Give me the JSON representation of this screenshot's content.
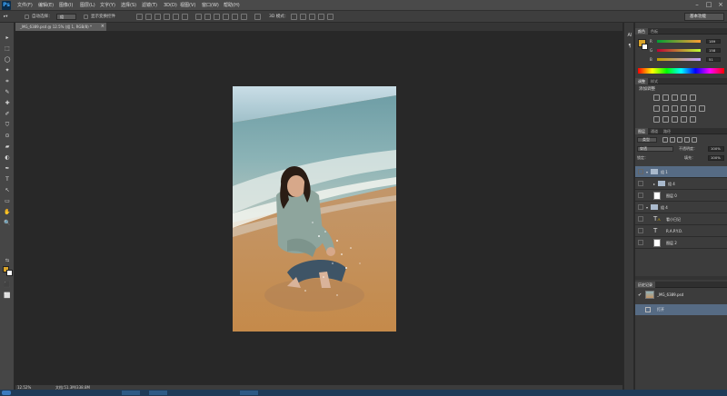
{
  "app": {
    "logo": "Ps",
    "menus": [
      "文件(F)",
      "编辑(E)",
      "图像(I)",
      "图层(L)",
      "文字(Y)",
      "选择(S)",
      "滤镜(T)",
      "3D(D)",
      "视图(V)",
      "窗口(W)",
      "帮助(H)"
    ],
    "window_controls": [
      "–",
      "□",
      "×"
    ]
  },
  "options": {
    "auto_select_label": "自动选择：",
    "auto_select_value": "组",
    "show_transform_label": "显示变换控件",
    "mode_3d_label": "3D 模式：",
    "workspace": "基本功能"
  },
  "tools": [
    "▸",
    "⬚",
    "◯",
    "✦",
    "⌗",
    "✎",
    "✚",
    "✐",
    "⛉",
    "⊙",
    "▰",
    "◐",
    "✒",
    "T",
    "↖",
    "▭",
    "✋",
    "🔍",
    "⇆",
    "⬛",
    "⬜"
  ],
  "document": {
    "tab_title": "_MG_6389.psd @ 12.5% (组 1, RGB/8) *",
    "close": "×"
  },
  "status": {
    "zoom": "12.52%",
    "doc_size": "文档:51.3M/338.8M"
  },
  "mid_column": {
    "icons": [
      "AI",
      "¶"
    ]
  },
  "color_panel": {
    "tabs": [
      "颜色",
      "色板"
    ],
    "channels": [
      {
        "label": "R",
        "value": "189"
      },
      {
        "label": "G",
        "value": "158"
      },
      {
        "label": "B",
        "value": "51"
      }
    ],
    "colors": {
      "foreground": "#d9a42a"
    }
  },
  "adjustments_panel": {
    "tabs": [
      "调整",
      "样式"
    ],
    "title": "添加调整"
  },
  "layers_panel": {
    "tabs": [
      "图层",
      "通道",
      "路径"
    ],
    "kind_label": "类型",
    "blend_mode": "穿透",
    "opacity_label": "不透明度：",
    "opacity_value": "100%",
    "lock_label": "锁定：",
    "fill_label": "填充：",
    "fill_value": "100%",
    "layers": [
      {
        "name": "组 1",
        "type": "group",
        "selected": true
      },
      {
        "name": "组 4",
        "type": "group",
        "selected": false
      },
      {
        "name": "图层 0",
        "type": "pixel",
        "selected": false
      },
      {
        "name": "组 4",
        "type": "group",
        "selected": false
      },
      {
        "name": "看小日记",
        "type": "text-warn",
        "selected": false
      },
      {
        "name": "R.A.P.Y.O.",
        "type": "text",
        "selected": false
      },
      {
        "name": "图层 2",
        "type": "pixel",
        "selected": false
      }
    ]
  },
  "history_panel": {
    "tabs": [
      "历史记录"
    ],
    "entries": [
      {
        "name": "_MG_6389.psd",
        "type": "snapshot"
      },
      {
        "name": "打开",
        "type": "step",
        "selected": true
      }
    ]
  }
}
